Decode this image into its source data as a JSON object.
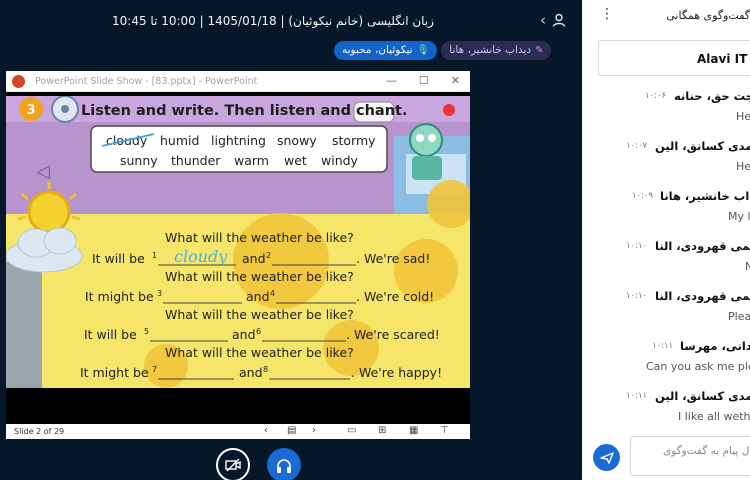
{
  "session": {
    "title": "زبان انگلیسی (خانم نیکوئیان) | 1405/01/18 | 10:00 تا 10:45"
  },
  "tags": [
    {
      "label": "نیکوئیان، محبوبه",
      "kind": "presenter"
    },
    {
      "label": "دیداب خانشیر، هانا",
      "kind": "annotator"
    }
  ],
  "ppt_window": {
    "title": "PowerPoint Slide Show - [83.pptx] - PowerPoint",
    "status": "Slide 2 of 29"
  },
  "slide": {
    "number": "3",
    "heading": "Listen and write. Then listen and chant.",
    "word_bank_row1": [
      "cloudy",
      "humid",
      "lightning",
      "snowy",
      "stormy"
    ],
    "word_bank_row2": [
      "sunny",
      "thunder",
      "warm",
      "wet",
      "windy"
    ],
    "question": "What will the weather be like?",
    "lines": [
      {
        "pre": "It will be",
        "n1": "1",
        "fill": "cloudy",
        "mid": "and",
        "n2": "2",
        "end": ". We're sad!"
      },
      {
        "pre": "It might be",
        "n1": "3",
        "fill": "",
        "mid": "and",
        "n2": "4",
        "end": ". We're cold!"
      },
      {
        "pre": "It will be",
        "n1": "5",
        "fill": "",
        "mid": "and",
        "n2": "6",
        "end": ". We're scared!"
      },
      {
        "pre": "It might be",
        "n1": "7",
        "fill": "",
        "mid": "and",
        "n2": "8",
        "end": ". We're happy!"
      }
    ]
  },
  "chat": {
    "header": "گفت‌وگوی همگانی",
    "pinned": "Alavi IT C",
    "input_placeholder": "ارسال پیام به گفت‌وگوی",
    "messages": [
      {
        "name": "بهجت حق، حنانه",
        "time": "۱۰:۰۶",
        "text": "He"
      },
      {
        "name": "صمدی کسانق، الین",
        "time": "۱۰:۰۷",
        "text": "He"
      },
      {
        "name": "دیداب خانشیر، هانا",
        "time": "۱۰:۰۹",
        "text": "My l"
      },
      {
        "name": "رحیمی قهرودی، النا",
        "time": "۱۰:۱۰",
        "text": "N"
      },
      {
        "name": "رحیمی قهرودی، النا",
        "time": "۱۰:۱۰",
        "text": "Plea"
      },
      {
        "name": "یزدانی، مهرسا",
        "time": "۱۰:۱۱",
        "text": "Can you ask me plea"
      },
      {
        "name": "صمدی کسانق، الین",
        "time": "۱۰:۱۱",
        "text": "I like all wethe"
      }
    ]
  }
}
